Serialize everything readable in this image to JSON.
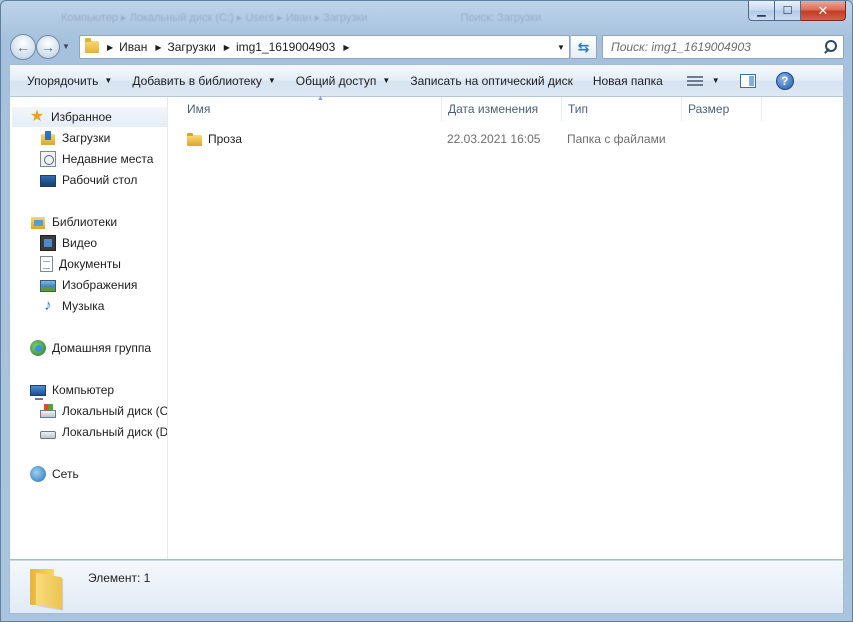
{
  "titlebar": {
    "ghost_path": [
      "Компьютер",
      "Локальный диск (C:)",
      "Users",
      "Иван",
      "Загрузки"
    ],
    "ghost_search": "Поиск: Загрузки"
  },
  "address": {
    "crumbs": [
      "Иван",
      "Загрузки",
      "img1_1619004903"
    ]
  },
  "search": {
    "placeholder": "Поиск: img1_1619004903"
  },
  "toolbar": {
    "organize": "Упорядочить",
    "add_to_library": "Добавить в библиотеку",
    "share": "Общий доступ",
    "burn": "Записать на оптический диск",
    "new_folder": "Новая папка"
  },
  "sidebar": {
    "favorites": "Избранное",
    "downloads": "Загрузки",
    "recent": "Недавние места",
    "desktop": "Рабочий стол",
    "libraries": "Библиотеки",
    "video": "Видео",
    "documents": "Документы",
    "images": "Изображения",
    "music": "Музыка",
    "homegroup": "Домашняя группа",
    "computer": "Компьютер",
    "disk_c": "Локальный диск (C:)",
    "disk_d": "Локальный диск (D:)",
    "network": "Сеть"
  },
  "columns": {
    "name": "Имя",
    "modified": "Дата изменения",
    "type": "Тип",
    "size": "Размер"
  },
  "files": [
    {
      "name": "Проза",
      "modified": "22.03.2021 16:05",
      "type": "Папка с файлами",
      "size": ""
    }
  ],
  "details": {
    "count": "Элемент: 1"
  },
  "colors": {
    "accent": "#2a79c4",
    "frame": "#a9c4de"
  }
}
